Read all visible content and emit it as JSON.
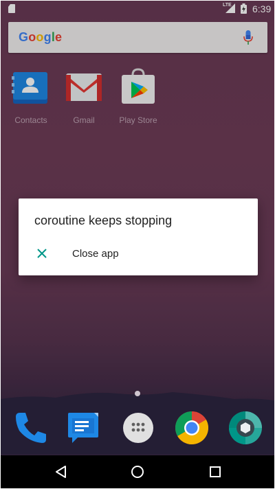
{
  "status_bar": {
    "time": "6:39",
    "network": "LTE"
  },
  "search": {
    "logo": [
      "G",
      "o",
      "o",
      "g",
      "l",
      "e"
    ],
    "logo_colors": [
      "#4285F4",
      "#EA4335",
      "#FBBC05",
      "#4285F4",
      "#34A853",
      "#EA4335"
    ],
    "mic_icon": "mic-icon"
  },
  "apps": [
    {
      "label": "Contacts",
      "icon": "contacts-icon"
    },
    {
      "label": "Gmail",
      "icon": "gmail-icon"
    },
    {
      "label": "Play Store",
      "icon": "play-store-icon"
    }
  ],
  "dialog": {
    "title": "coroutine keeps stopping",
    "action_label": "Close app",
    "action_icon": "close-icon",
    "accent": "#009688"
  },
  "dock": [
    {
      "icon": "phone-icon"
    },
    {
      "icon": "messages-icon"
    },
    {
      "icon": "app-drawer-icon"
    },
    {
      "icon": "chrome-icon"
    },
    {
      "icon": "camera-icon"
    }
  ],
  "nav": {
    "back": "back-icon",
    "home": "home-icon",
    "recents": "recents-icon"
  }
}
